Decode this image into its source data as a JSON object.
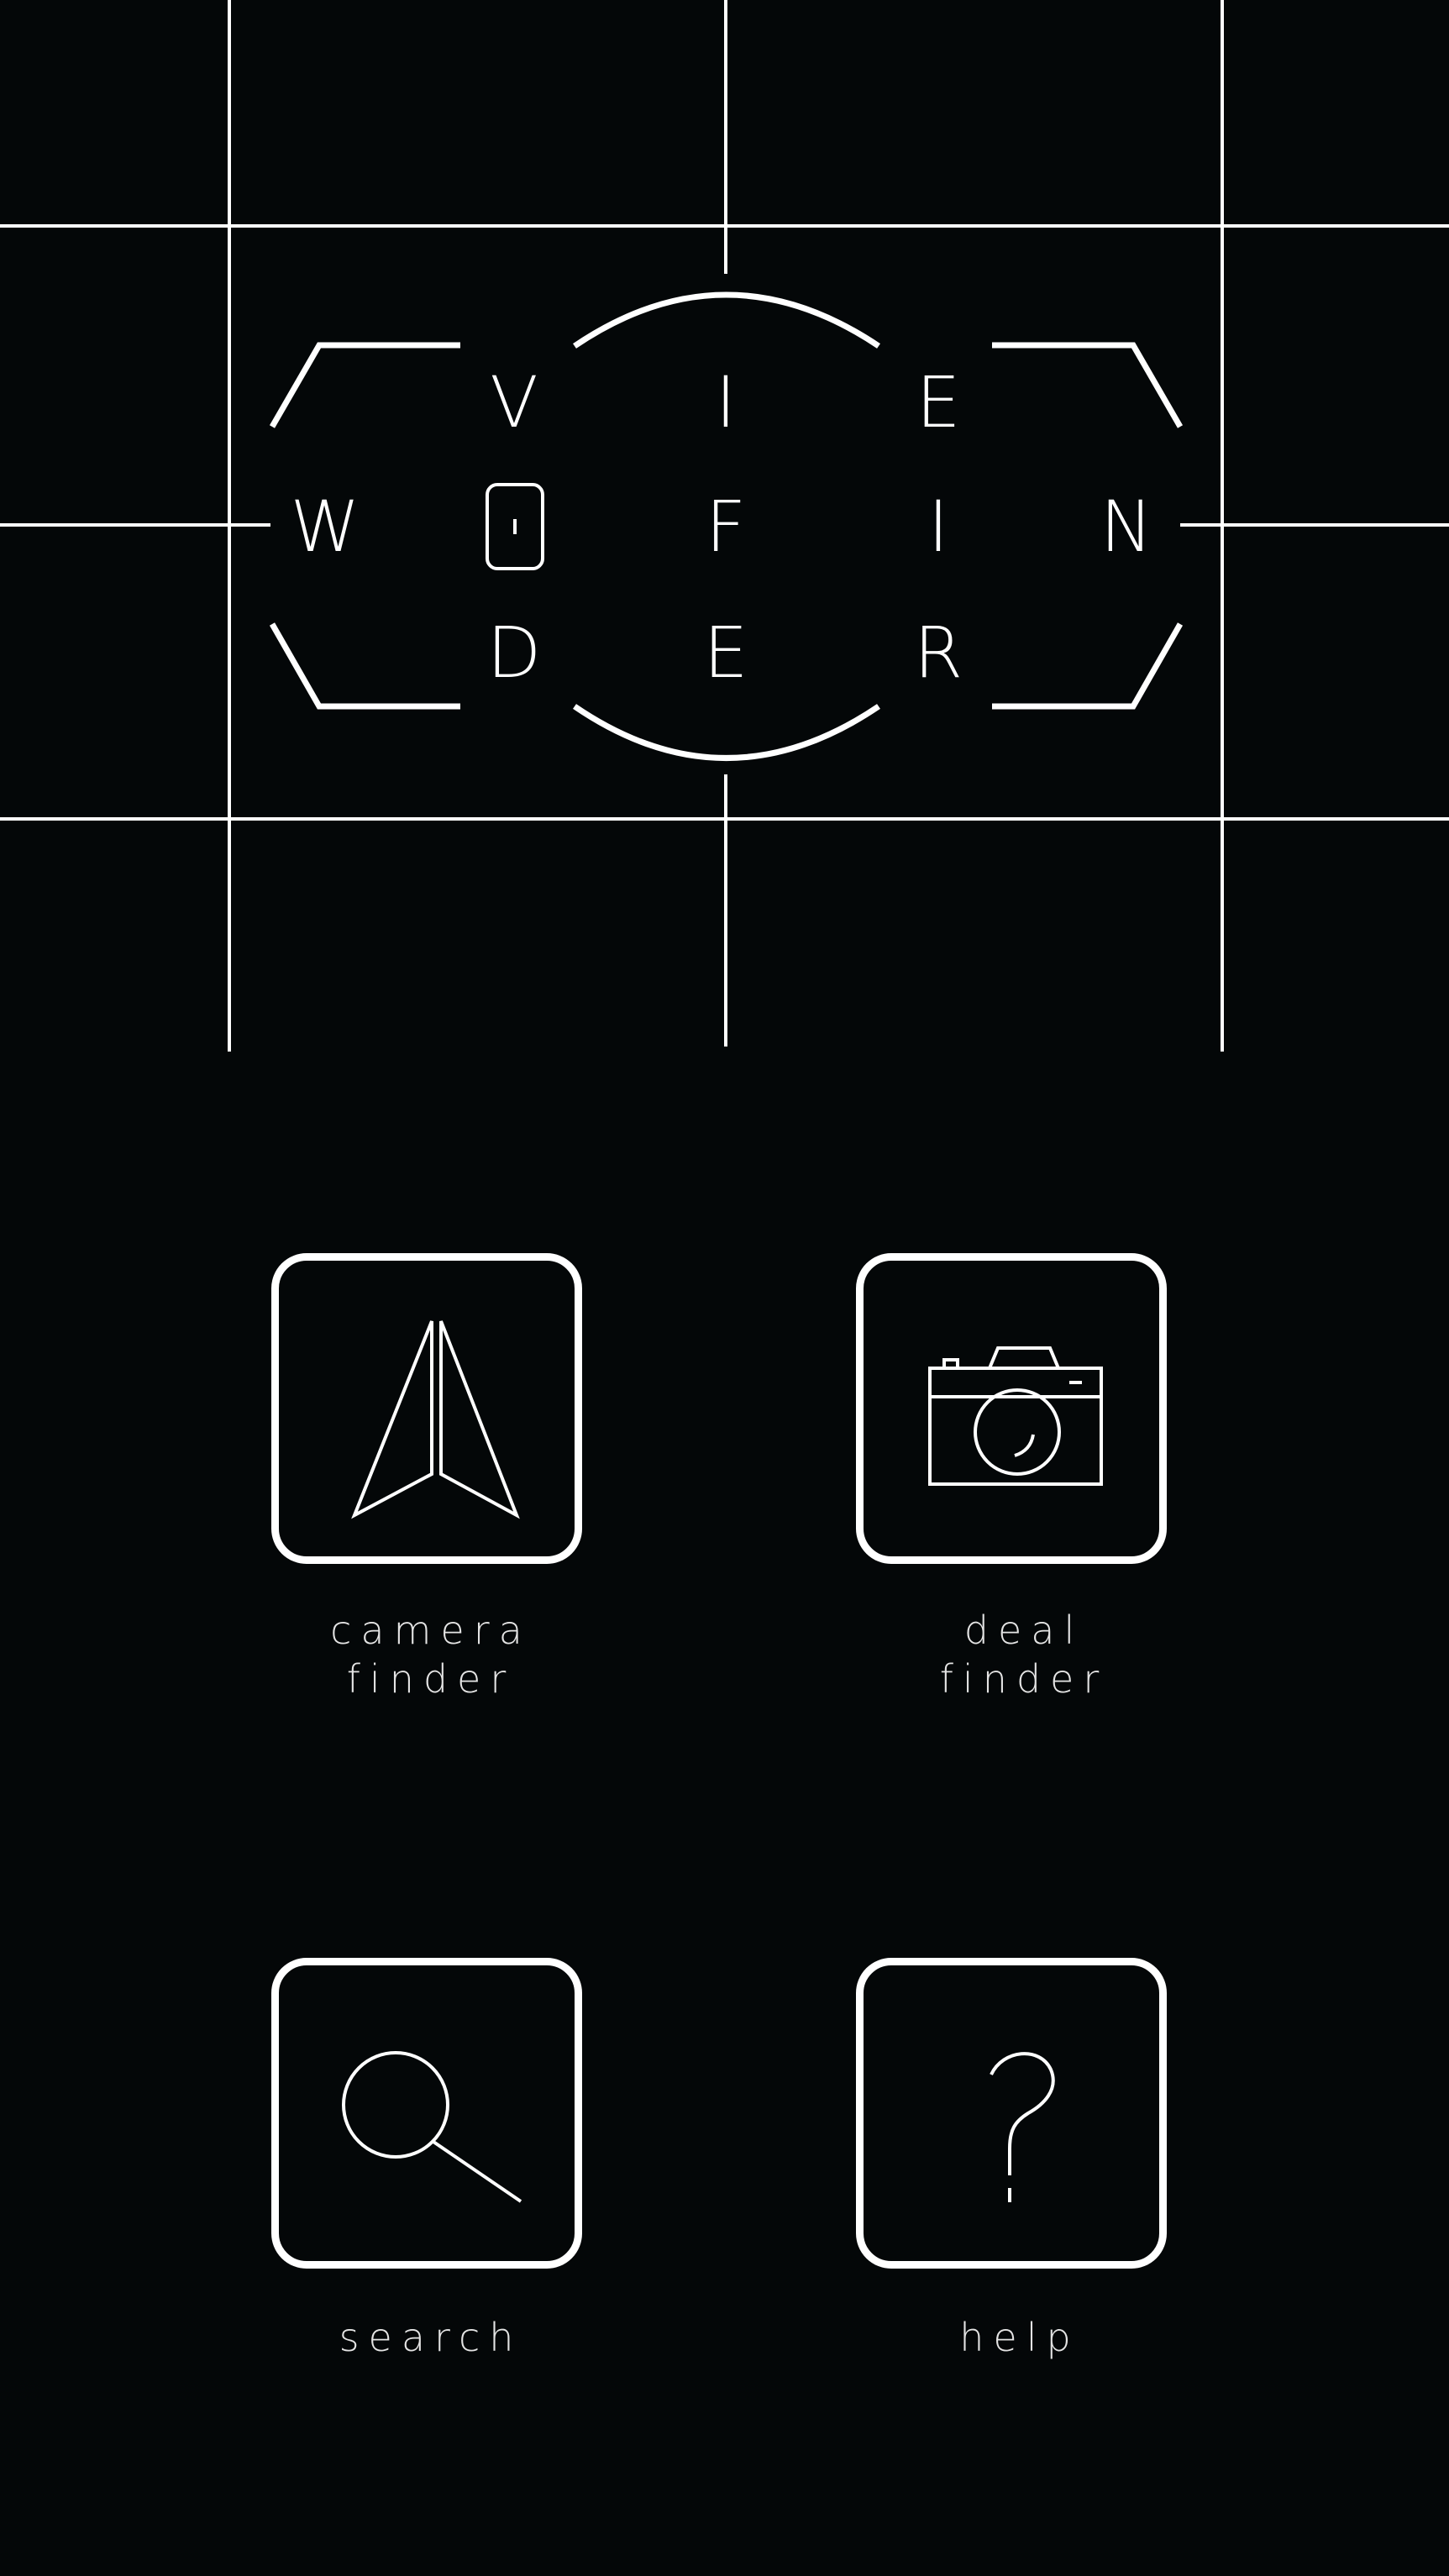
{
  "logo": {
    "letters": {
      "r1c1": "V",
      "r1c2": "I",
      "r1c3": "E",
      "r2c0": "W",
      "r2c2": "F",
      "r2c3": "I",
      "r2c4": "N",
      "r3c1": "D",
      "r3c2": "E",
      "r3c3": "R"
    }
  },
  "menu": {
    "camera_finder": {
      "line1": "camera",
      "line2": "finder",
      "icon": "paper-plane-arrow-icon"
    },
    "deal_finder": {
      "line1": "deal",
      "line2": "finder",
      "icon": "camera-icon"
    },
    "search": {
      "label": "search",
      "icon": "magnifier-icon"
    },
    "help": {
      "label": "help",
      "icon": "question-mark-icon"
    }
  },
  "colors": {
    "background": "#040708",
    "foreground": "#ffffff"
  }
}
